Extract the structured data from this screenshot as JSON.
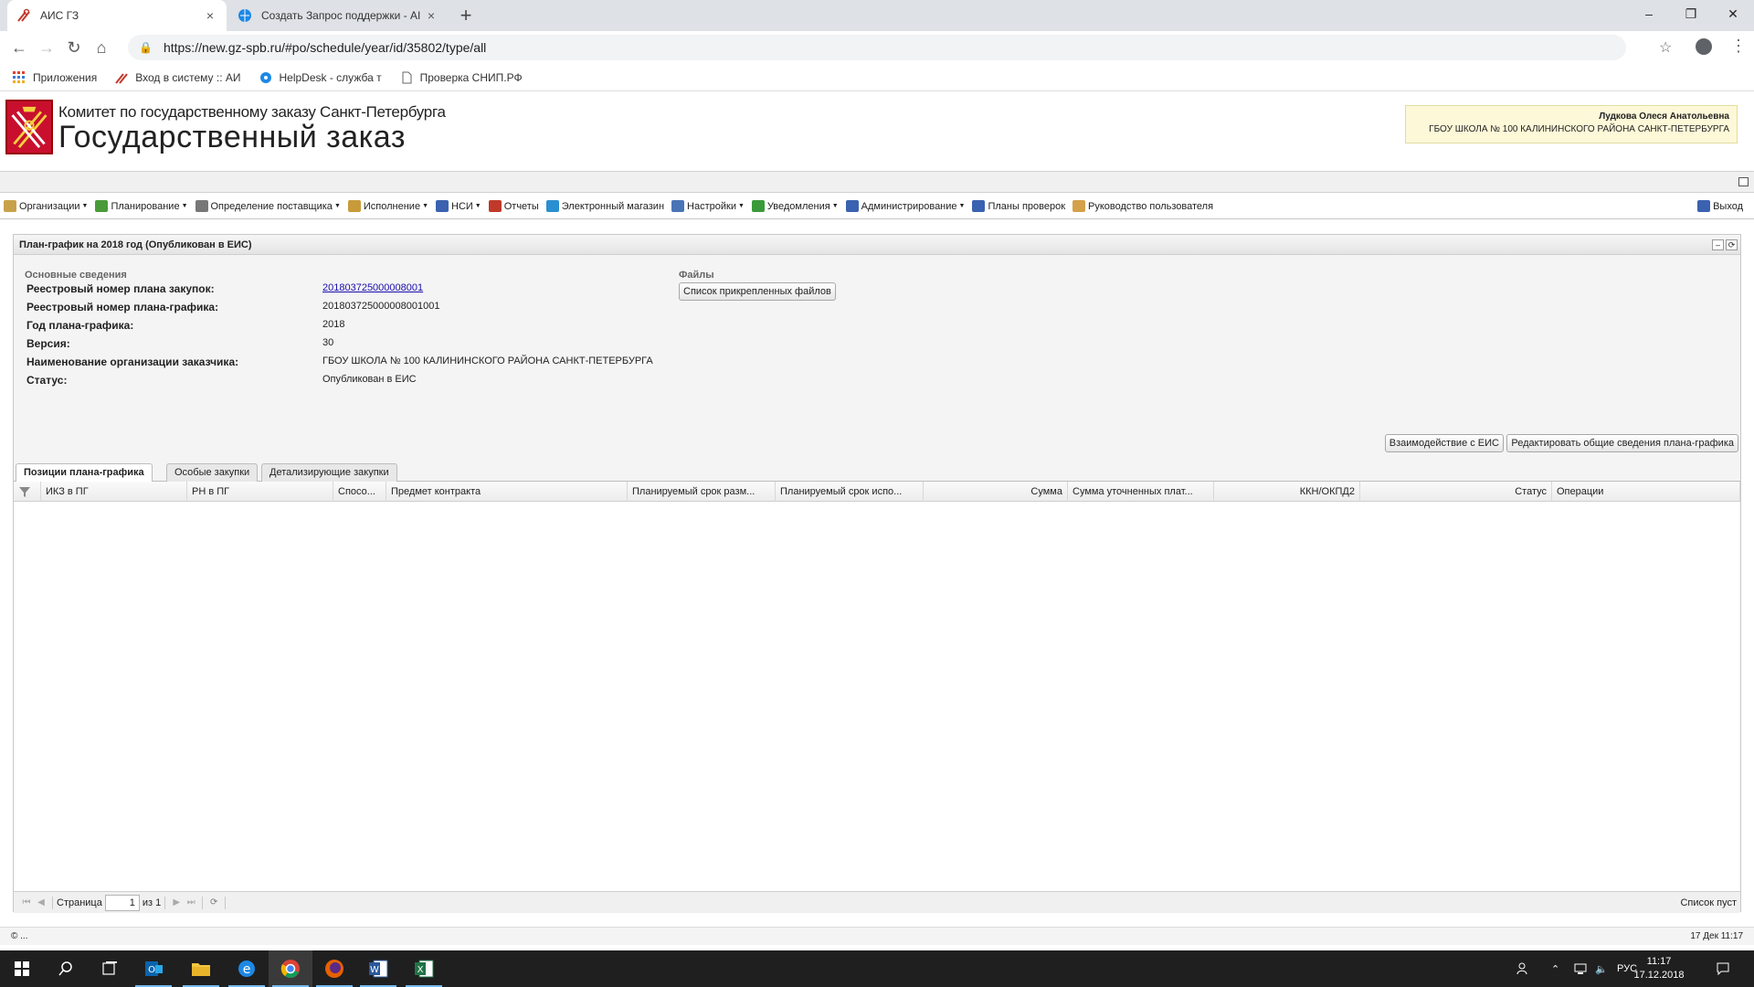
{
  "browser": {
    "tabs": [
      {
        "title": "АИС ГЗ",
        "close": "×"
      },
      {
        "title": "Создать Запрос поддержки - AI",
        "close": "×"
      }
    ],
    "new_tab": "+",
    "url": "https://new.gz-spb.ru/#po/schedule/year/id/35802/type/all",
    "window_buttons": {
      "minimize": "–",
      "maximize": "❐",
      "close": "✕"
    },
    "bookmarks": [
      "Приложения",
      "Вход в систему :: АИ",
      "HelpDesk - служба т",
      "Проверка СНИП.РФ"
    ]
  },
  "header": {
    "subtitle": "Комитет по государственному заказу Санкт-Петербурга",
    "title": "Государственный заказ",
    "user_name": "Лудкова Олеся Анатольевна",
    "user_org": "ГБОУ ШКОЛА № 100 КАЛИНИНСКОГО РАЙОНА САНКТ-ПЕТЕРБУРГА"
  },
  "menu": {
    "items": [
      {
        "label": "Организации",
        "dropdown": true,
        "icon": "folder-icon",
        "color": "#c8a24a"
      },
      {
        "label": "Планирование",
        "dropdown": true,
        "icon": "tree-icon",
        "color": "#4a9a3a"
      },
      {
        "label": "Определение поставщика",
        "dropdown": true,
        "icon": "gears-icon",
        "color": "#777777"
      },
      {
        "label": "Исполнение",
        "dropdown": true,
        "icon": "box-icon",
        "color": "#c89b3a"
      },
      {
        "label": "НСИ",
        "dropdown": true,
        "icon": "book-icon",
        "color": "#3a62b0"
      },
      {
        "label": "Отчеты",
        "dropdown": false,
        "icon": "report-icon",
        "color": "#c0392b"
      },
      {
        "label": "Электронный магазин",
        "dropdown": false,
        "icon": "cart-icon",
        "color": "#2a8fd0"
      },
      {
        "label": "Настройки",
        "dropdown": true,
        "icon": "wrench-icon",
        "color": "#4a74b8"
      },
      {
        "label": "Уведомления",
        "dropdown": true,
        "icon": "notice-icon",
        "color": "#3a9a3a"
      },
      {
        "label": "Администрирование",
        "dropdown": true,
        "icon": "user-icon",
        "color": "#3a62b0"
      },
      {
        "label": "Планы проверок",
        "dropdown": false,
        "icon": "user-icon",
        "color": "#3a62b0"
      },
      {
        "label": "Руководство пользователя",
        "dropdown": false,
        "icon": "manual-icon",
        "color": "#d4a04a"
      }
    ],
    "exit": "Выход"
  },
  "panel": {
    "title": "План-график на 2018 год (Опубликован в ЕИС)",
    "section_main": "Основные сведения",
    "section_files": "Файлы",
    "files_button": "Список прикрепленных файлов",
    "fields": [
      {
        "label": "Реестровый номер плана закупок:",
        "value": "201803725000008001",
        "link": true
      },
      {
        "label": "Реестровый номер плана-графика:",
        "value": "201803725000008001001",
        "link": false
      },
      {
        "label": "Год плана-графика:",
        "value": "2018",
        "link": false
      },
      {
        "label": "Версия:",
        "value": "30",
        "link": false
      },
      {
        "label": "Наименование организации заказчика:",
        "value": "ГБОУ ШКОЛА № 100 КАЛИНИНСКОГО РАЙОНА САНКТ-ПЕТЕРБУРГА",
        "link": false
      },
      {
        "label": "Статус:",
        "value": "Опубликован в ЕИС",
        "link": false
      }
    ],
    "actions": [
      "Взаимодействие с ЕИС",
      "Редактировать общие сведения плана-графика"
    ],
    "tabs": [
      "Позиции плана-графика",
      "Особые закупки",
      "Детализирующие закупки"
    ],
    "active_tab": 0,
    "columns": [
      "ИКЗ в ПГ",
      "РН в ПГ",
      "Спосо...",
      "Предмет контракта",
      "Планируемый срок разм...",
      "Планируемый срок испо...",
      "Сумма",
      "Сумма уточненных плат...",
      "ККН/ОКПД2",
      "Статус",
      "Операции"
    ],
    "rows": [],
    "pager": {
      "page_label": "Страница",
      "page": "1",
      "of_label": "из 1",
      "empty": "Список пуст"
    }
  },
  "statusbar": {
    "left": "© ...",
    "right": "17 Дек 11:17"
  },
  "taskbar": {
    "apps": [
      "start-icon",
      "search-icon",
      "taskview-icon",
      "outlook-icon",
      "explorer-icon",
      "edge-icon",
      "chrome-icon",
      "firefox-icon",
      "word-icon",
      "excel-icon"
    ],
    "lang": "РУС",
    "time": "11:17",
    "date": "17.12.2018"
  }
}
